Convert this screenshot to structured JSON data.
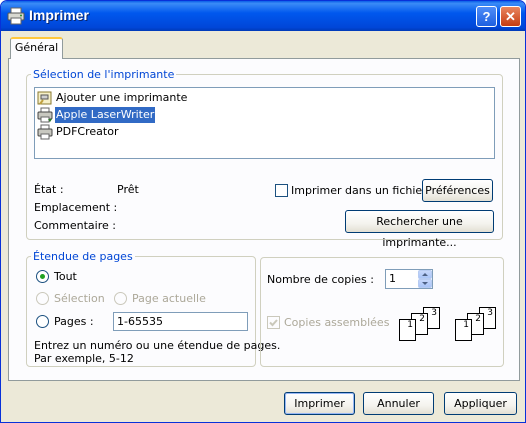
{
  "window": {
    "title": "Imprimer",
    "help_glyph": "?",
    "close_glyph": "✕"
  },
  "tabs": [
    {
      "label": "Général",
      "selected": true
    }
  ],
  "printer_selection": {
    "legend": "Sélection de l'imprimante",
    "printers": [
      {
        "name": "Ajouter une imprimante",
        "icon": "add-printer-icon",
        "selected": false
      },
      {
        "name": "Apple LaserWriter",
        "icon": "printer-icon",
        "selected": true
      },
      {
        "name": "PDFCreator",
        "icon": "printer-icon",
        "selected": false
      }
    ],
    "status_label": "État :",
    "status_value": "Prêt",
    "location_label": "Emplacement :",
    "location_value": "",
    "comment_label": "Commentaire :",
    "comment_value": "",
    "print_to_file_label": "Imprimer dans un fichier",
    "print_to_file_checked": false,
    "preferences_button": "Préférences",
    "find_printer_button": "Rechercher une imprimante..."
  },
  "page_range": {
    "legend": "Étendue de pages",
    "all_label": "Tout",
    "selection_label": "Sélection",
    "current_page_label": "Page actuelle",
    "pages_label": "Pages :",
    "pages_value": "1-65535",
    "hint_line1": "Entrez un numéro ou une étendue de pages.",
    "hint_line2": "Par exemple, 5-12",
    "selected_option": "all"
  },
  "copies": {
    "count_label": "Nombre de copies :",
    "count_value": "1",
    "collate_label": "Copies assemblées",
    "collate_checked": true,
    "collate_enabled": false,
    "page_numbers": [
      "1",
      "2",
      "3"
    ]
  },
  "buttons": {
    "print": "Imprimer",
    "cancel": "Annuler",
    "apply": "Appliquer"
  },
  "colors": {
    "titlebar": "#0058ee",
    "dialog_bg": "#ece9d8",
    "group_legend": "#0046d5",
    "selection": "#316ac5",
    "radio_dot": "#21a121"
  }
}
